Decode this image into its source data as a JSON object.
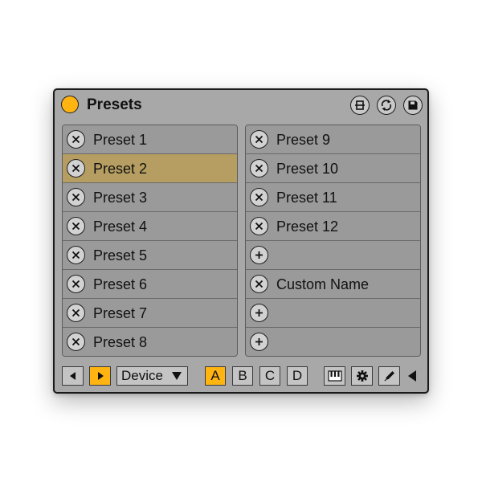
{
  "window": {
    "title": "Presets"
  },
  "titlebar_icons": [
    {
      "name": "map-device-icon"
    },
    {
      "name": "sync-icon"
    },
    {
      "name": "save-icon"
    }
  ],
  "colors": {
    "accent": "#ffb412",
    "selected_slot": "#b69e62",
    "panel": "#9a9a9a",
    "body": "#a8a8a8"
  },
  "left_slots": [
    {
      "label": "Preset 1",
      "button": "remove-icon"
    },
    {
      "label": "Preset 2",
      "button": "remove-icon",
      "selected": true
    },
    {
      "label": "Preset 3",
      "button": "remove-icon"
    },
    {
      "label": "Preset 4",
      "button": "remove-icon"
    },
    {
      "label": "Preset 5",
      "button": "remove-icon"
    },
    {
      "label": "Preset 6",
      "button": "remove-icon"
    },
    {
      "label": "Preset 7",
      "button": "remove-icon"
    },
    {
      "label": "Preset 8",
      "button": "remove-icon"
    }
  ],
  "right_slots": [
    {
      "label": "Preset 9",
      "button": "remove-icon"
    },
    {
      "label": "Preset 10",
      "button": "remove-icon"
    },
    {
      "label": "Preset 11",
      "button": "remove-icon"
    },
    {
      "label": "Preset 12",
      "button": "remove-icon"
    },
    {
      "label": "",
      "button": "add-icon"
    },
    {
      "label": "Custom Name",
      "button": "remove-icon"
    },
    {
      "label": "",
      "button": "add-icon"
    },
    {
      "label": "",
      "button": "add-icon"
    }
  ],
  "bottom": {
    "prev_icon": "arrow-left-icon",
    "next_icon": "arrow-right-icon",
    "target_select": "Device",
    "banks": [
      "A",
      "B",
      "C",
      "D"
    ],
    "active_bank": "A",
    "tools": [
      "piano-keys-icon",
      "gear-icon",
      "pencil-icon",
      "collapse-triangle-icon"
    ]
  }
}
